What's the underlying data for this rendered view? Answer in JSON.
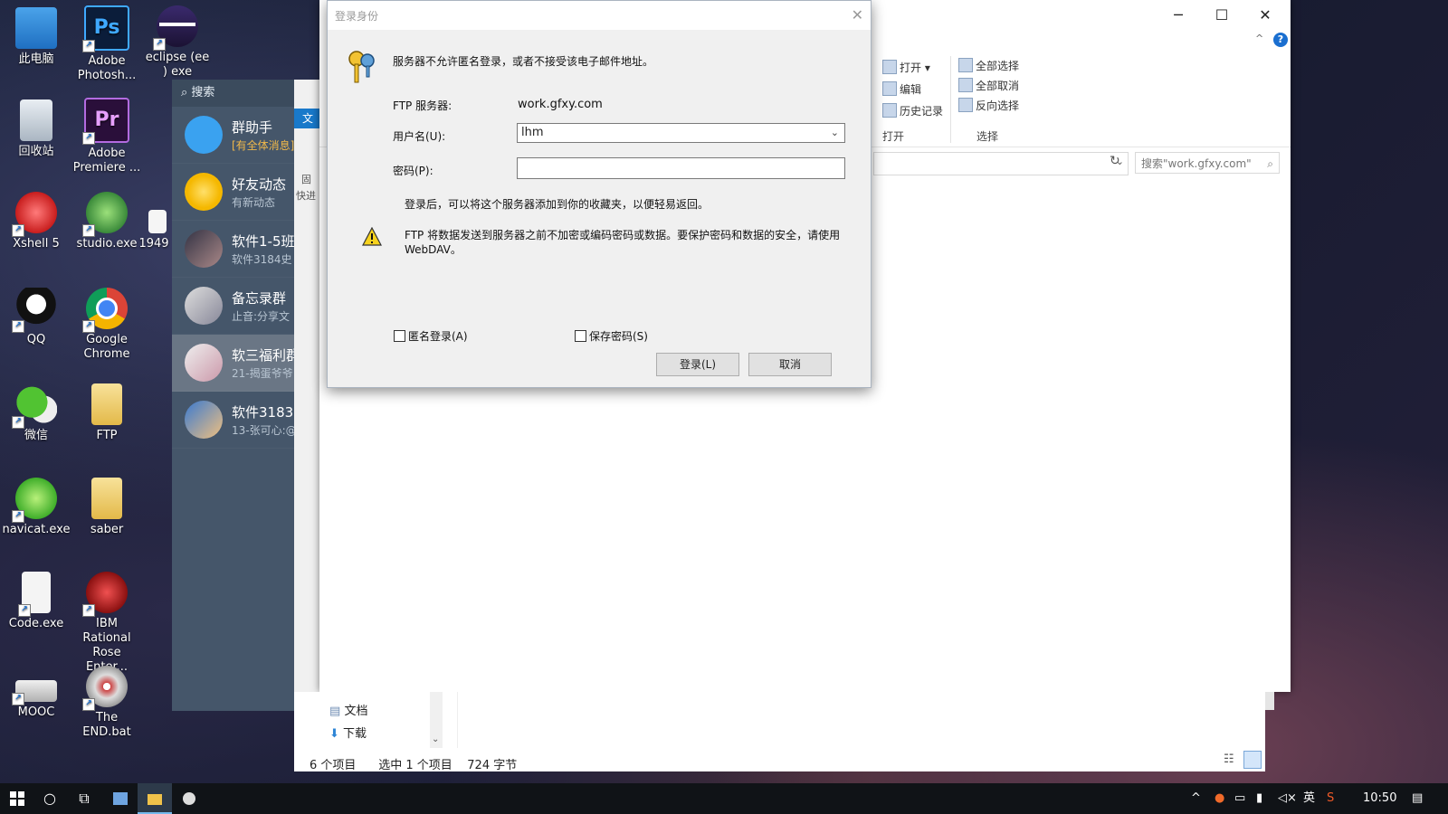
{
  "desktop_icons": [
    {
      "label": "此电脑",
      "icon": "computer-icon"
    },
    {
      "label": "Adobe Photosh...",
      "icon": "photoshop-icon"
    },
    {
      "label": "eclipse (ee ) exe",
      "icon": "eclipse-icon"
    },
    {
      "label": "回收站",
      "icon": "recycle-bin-icon"
    },
    {
      "label": "Adobe Premiere ...",
      "icon": "premiere-icon"
    },
    {
      "label": "Xshell 5",
      "icon": "xshell-icon"
    },
    {
      "label": "studio.exe",
      "icon": "android-studio-icon"
    },
    {
      "label": "1949",
      "icon": "file-icon"
    },
    {
      "label": "QQ",
      "icon": "qq-icon"
    },
    {
      "label": "Google Chrome",
      "icon": "chrome-icon"
    },
    {
      "label": "微信",
      "icon": "wechat-icon"
    },
    {
      "label": "FTP",
      "icon": "folder-icon"
    },
    {
      "label": "navicat.exe",
      "icon": "navicat-icon"
    },
    {
      "label": "saber",
      "icon": "folder-icon"
    },
    {
      "label": "Code.exe",
      "icon": "file-icon"
    },
    {
      "label": "IBM Rational Rose Enter...",
      "icon": "rational-rose-icon"
    },
    {
      "label": "MOOC",
      "icon": "mooc-icon"
    },
    {
      "label": "The END.bat",
      "icon": "cd-icon"
    }
  ],
  "qq": {
    "search_label": "搜索",
    "items": [
      {
        "name": "群助手",
        "sub": "[有全体消息]"
      },
      {
        "name": "好友动态",
        "sub": "有新动态"
      },
      {
        "name": "软件1-5班",
        "sub": "软件3184史"
      },
      {
        "name": "备忘录群",
        "sub": "止音:分享文"
      },
      {
        "name": "软三福利群",
        "sub": "21-揭蛋爷爷"
      },
      {
        "name": "软件3183",
        "sub": "13-张可心:@"
      }
    ]
  },
  "explorer": {
    "controls": {
      "minimize": "─",
      "maximize": "☐",
      "close": "✕"
    },
    "help": "?",
    "ribbon": {
      "open": "打开",
      "edit": "编辑",
      "history": "历史记录",
      "group_open": "打开",
      "select_all": "全部选择",
      "select_none": "全部取消",
      "invert": "反向选择",
      "group_select": "选择"
    },
    "left_tab": "文",
    "left_labels": [
      "固",
      "快进"
    ],
    "search_placeholder": "搜索\"work.gfxy.com\"",
    "nav": {
      "documents": "文档",
      "downloads": "下载"
    },
    "status": {
      "count": "6 个项目",
      "selected": "选中 1 个项目",
      "size": "724 字节"
    }
  },
  "dialog": {
    "title": "登录身份",
    "message": "服务器不允许匿名登录，或者不接受该电子邮件地址。",
    "ftp_server_label": "FTP 服务器:",
    "ftp_server_value": "work.gfxy.com",
    "username_label": "用户名(U):",
    "username_value": "lhm",
    "password_label": "密码(P):",
    "password_value": "",
    "info": "登录后，可以将这个服务器添加到你的收藏夹，以便轻易返回。",
    "warning_line1": "FTP 将数据发送到服务器之前不加密或编码密码或数据。要保护密码和数据的安全，请使用",
    "warning_line2": "WebDAV。",
    "anon_label": "匿名登录(A)",
    "save_pwd_label": "保存密码(S)",
    "login_button": "登录(L)",
    "cancel_button": "取消"
  },
  "taskbar": {
    "time": "10:50",
    "ime": "英"
  }
}
